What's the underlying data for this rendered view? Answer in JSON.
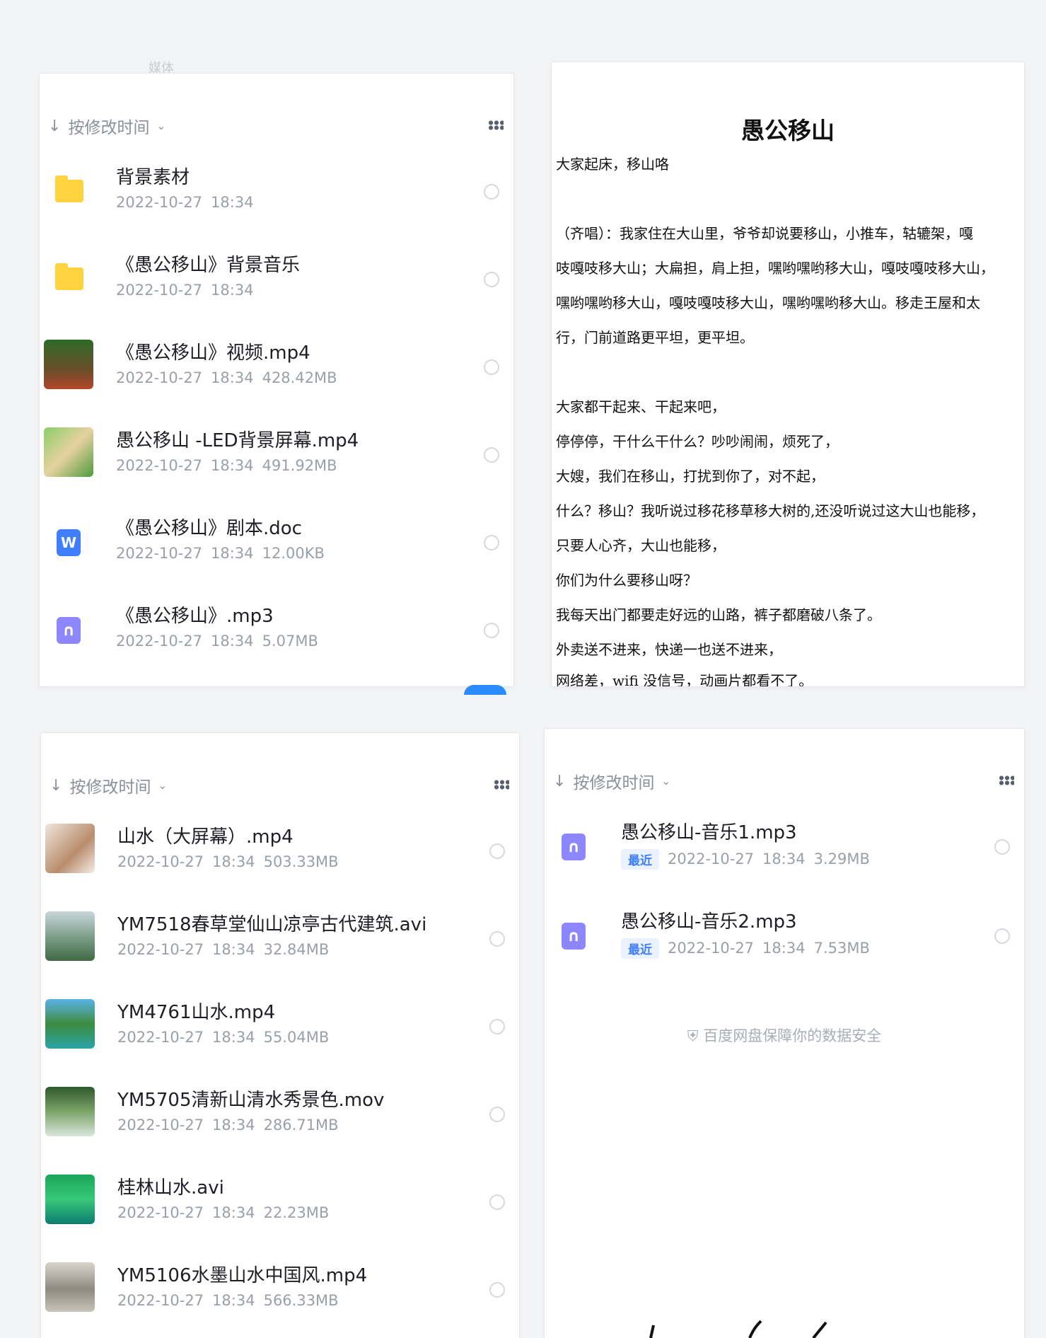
{
  "top_scrap": "媒体",
  "panel1": {
    "sort_label": "按修改时间",
    "files": [
      {
        "icon": "folder-icon",
        "name": "背景素材",
        "date": "2022-10-27",
        "time": "18:34",
        "size": ""
      },
      {
        "icon": "folder-icon",
        "name": "《愚公移山》背景音乐",
        "date": "2022-10-27",
        "time": "18:34",
        "size": ""
      },
      {
        "icon": "video-thumbnail",
        "name": "《愚公移山》视频.mp4",
        "date": "2022-10-27",
        "time": "18:34",
        "size": "428.42MB"
      },
      {
        "icon": "video-thumbnail",
        "name": "愚公移山 -LED背景屏幕.mp4",
        "date": "2022-10-27",
        "time": "18:34",
        "size": "491.92MB"
      },
      {
        "icon": "word-doc-icon",
        "name": "《愚公移山》剧本.doc",
        "date": "2022-10-27",
        "time": "18:34",
        "size": "12.00KB"
      },
      {
        "icon": "audio-file-icon",
        "name": "《愚公移山》.mp3",
        "date": "2022-10-27",
        "time": "18:34",
        "size": "5.07MB"
      }
    ]
  },
  "document": {
    "title": "愚公移山",
    "lines": [
      "大家起床，移山咯",
      "",
      "（齐唱）：我家住在大山里，爷爷却说要移山，小推车，轱辘架，嘎",
      "吱嘎吱移大山；大扁担，肩上担，嘿哟嘿哟移大山，嘎吱嘎吱移大山，",
      "嘿哟嘿哟移大山，嘎吱嘎吱移大山，嘿哟嘿哟移大山。移走王屋和太",
      "行，门前道路更平坦，更平坦。",
      "",
      "大家都干起来、干起来吧，",
      "停停停，干什么干什么？吵吵闹闹，烦死了，",
      "大嫂，我们在移山，打扰到你了，对不起，",
      "什么？移山？我听说过移花移草移大树的,还没听说过这大山也能移，",
      "只要人心齐，大山也能移，",
      "你们为什么要移山呀？",
      "我每天出门都要走好远的山路，裤子都磨破八条了。",
      "外卖送不进来，快递一也送不进来，",
      "网络差，wifi 没信号，动画片都看不了。"
    ]
  },
  "panel3": {
    "sort_label": "按修改时间",
    "files": [
      {
        "name": "山水（大屏幕）.mp4",
        "date": "2022-10-27",
        "time": "18:34",
        "size": "503.33MB"
      },
      {
        "name": "YM7518春草堂仙山凉亭古代建筑.avi",
        "date": "2022-10-27",
        "time": "18:34",
        "size": "32.84MB"
      },
      {
        "name": "YM4761山水.mp4",
        "date": "2022-10-27",
        "time": "18:34",
        "size": "55.04MB"
      },
      {
        "name": "YM5705清新山清水秀景色.mov",
        "date": "2022-10-27",
        "time": "18:34",
        "size": "286.71MB"
      },
      {
        "name": "桂林山水.avi",
        "date": "2022-10-27",
        "time": "18:34",
        "size": "22.23MB"
      },
      {
        "name": "YM5106水墨山水中国风.mp4",
        "date": "2022-10-27",
        "time": "18:34",
        "size": "566.33MB"
      }
    ]
  },
  "panel4": {
    "sort_label": "按修改时间",
    "files": [
      {
        "name": "愚公移山-音乐1.mp3",
        "tag": "最近",
        "date": "2022-10-27",
        "time": "18:34",
        "size": "3.29MB"
      },
      {
        "name": "愚公移山-音乐2.mp3",
        "tag": "最近",
        "date": "2022-10-27",
        "time": "18:34",
        "size": "7.53MB"
      }
    ],
    "footer": "百度网盘保障你的数据安全"
  }
}
